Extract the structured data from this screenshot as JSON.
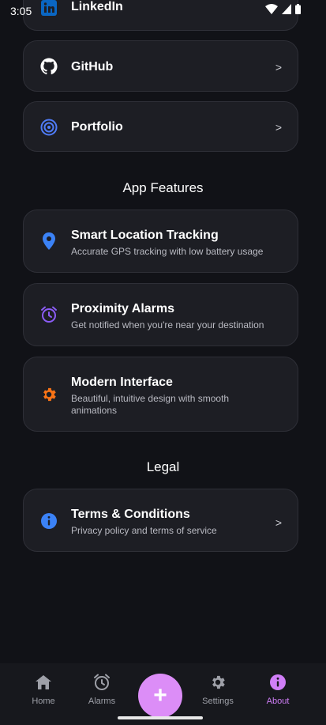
{
  "status_bar": {
    "time": "3:05"
  },
  "links": [
    {
      "label": "LinkedIn",
      "icon": "linkedin-icon"
    },
    {
      "label": "GitHub",
      "icon": "github-icon",
      "chevron": ">"
    },
    {
      "label": "Portfolio",
      "icon": "target-icon",
      "chevron": ">"
    }
  ],
  "features": {
    "heading": "App Features",
    "items": [
      {
        "title": "Smart Location Tracking",
        "subtitle": "Accurate GPS tracking with low battery usage",
        "icon": "location-pin-icon",
        "color": "#3b82f6"
      },
      {
        "title": "Proximity Alarms",
        "subtitle": "Get notified when you're near your destination",
        "icon": "alarm-clock-icon",
        "color": "#8b5cf6"
      },
      {
        "title": "Modern Interface",
        "subtitle": "Beautiful, intuitive design with smooth animations",
        "icon": "gear-icon",
        "color": "#f97316"
      }
    ]
  },
  "legal": {
    "heading": "Legal",
    "items": [
      {
        "title": "Terms & Conditions",
        "subtitle": "Privacy policy and terms of service",
        "icon": "info-icon",
        "chevron": ">",
        "color": "#3b82f6"
      }
    ]
  },
  "bottom_nav": {
    "items": [
      {
        "label": "Home",
        "icon": "home-icon"
      },
      {
        "label": "Alarms",
        "icon": "alarm-clock-icon"
      },
      {
        "label": "Settings",
        "icon": "gear-icon"
      },
      {
        "label": "About",
        "icon": "info-icon",
        "active": true
      }
    ],
    "fab": {
      "label": "+",
      "icon": "plus-icon"
    },
    "active_color": "#d07ef7"
  }
}
